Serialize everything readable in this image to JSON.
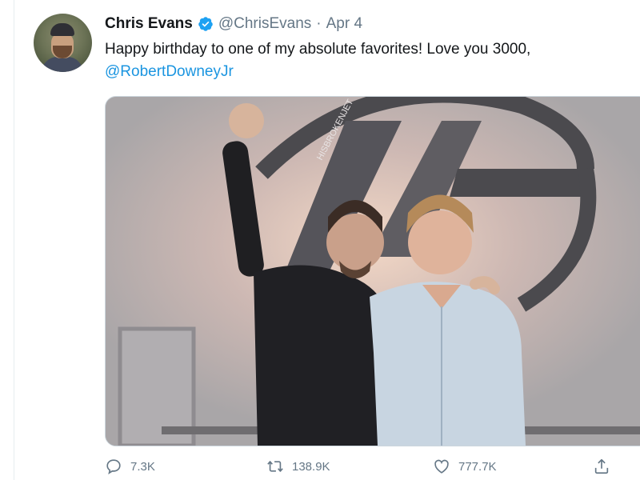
{
  "tweet": {
    "author_name": "Chris Evans",
    "handle": "@ChrisEvans",
    "separator": "·",
    "date": "Apr 4",
    "text": "Happy birthday to one of my absolute favorites! Love you 3000, ",
    "mention": "@RobertDowneyJr",
    "verified": true
  },
  "photo": {
    "watermark": "HISBROKENJET"
  },
  "actions": {
    "replies": "7.3K",
    "retweets": "138.9K",
    "likes": "777.7K"
  },
  "icons": {
    "reply": "reply-icon",
    "retweet": "retweet-icon",
    "like": "heart-icon",
    "share": "share-icon",
    "verified": "verified-badge-icon"
  },
  "colors": {
    "link": "#1b95e0",
    "verified": "#1da1f2",
    "secondary_text": "#657786",
    "primary_text": "#14171a"
  }
}
